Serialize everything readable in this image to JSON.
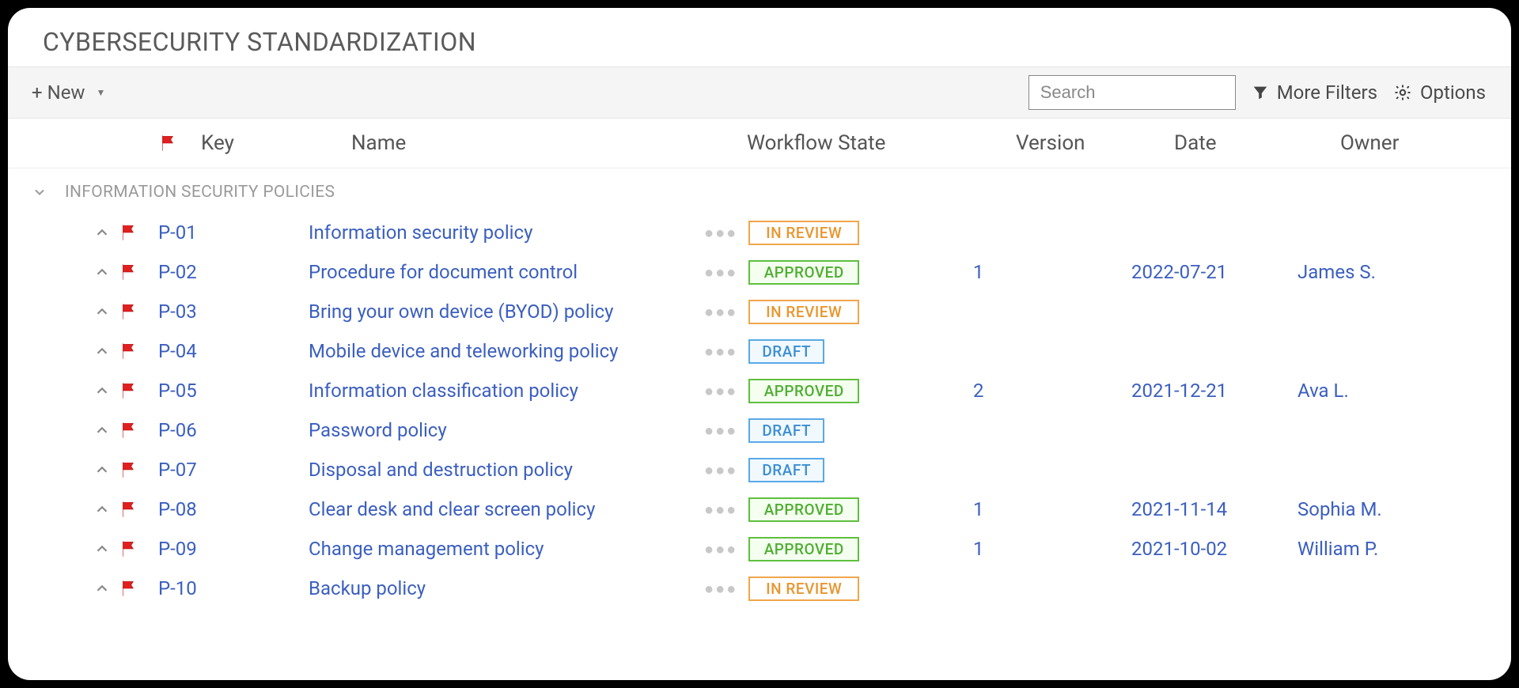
{
  "title": "CYBERSECURITY STANDARDIZATION",
  "toolbar": {
    "new_label": "+ New",
    "search_placeholder": "Search",
    "filters_label": "More Filters",
    "options_label": "Options"
  },
  "columns": {
    "key": "Key",
    "name": "Name",
    "state": "Workflow State",
    "version": "Version",
    "date": "Date",
    "owner": "Owner"
  },
  "group": {
    "label": "INFORMATION SECURITY POLICIES"
  },
  "states": {
    "review": "IN REVIEW",
    "approved": "APPROVED",
    "draft": "DRAFT"
  },
  "rows": [
    {
      "key": "P-01",
      "name": "Information security policy",
      "state": "review",
      "version": "",
      "date": "",
      "owner": ""
    },
    {
      "key": "P-02",
      "name": "Procedure for document control",
      "state": "approved",
      "version": "1",
      "date": "2022-07-21",
      "owner": "James S."
    },
    {
      "key": "P-03",
      "name": "Bring your own device (BYOD) policy",
      "state": "review",
      "version": "",
      "date": "",
      "owner": ""
    },
    {
      "key": "P-04",
      "name": "Mobile device and teleworking policy",
      "state": "draft",
      "version": "",
      "date": "",
      "owner": ""
    },
    {
      "key": "P-05",
      "name": "Information classification policy",
      "state": "approved",
      "version": "2",
      "date": "2021-12-21",
      "owner": "Ava L."
    },
    {
      "key": "P-06",
      "name": "Password policy",
      "state": "draft",
      "version": "",
      "date": "",
      "owner": ""
    },
    {
      "key": "P-07",
      "name": "Disposal and destruction policy",
      "state": "draft",
      "version": "",
      "date": "",
      "owner": ""
    },
    {
      "key": "P-08",
      "name": "Clear desk and clear screen policy",
      "state": "approved",
      "version": "1",
      "date": "2021-11-14",
      "owner": "Sophia M."
    },
    {
      "key": "P-09",
      "name": "Change management policy",
      "state": "approved",
      "version": "1",
      "date": "2021-10-02",
      "owner": "William P."
    },
    {
      "key": "P-10",
      "name": "Backup policy",
      "state": "review",
      "version": "",
      "date": "",
      "owner": ""
    }
  ]
}
